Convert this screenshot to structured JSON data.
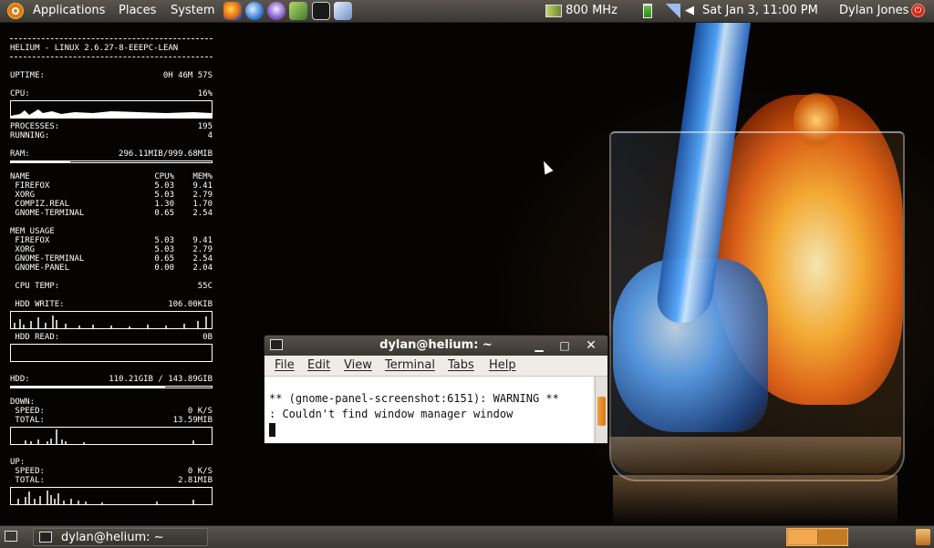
{
  "top_panel": {
    "menus": [
      "Applications",
      "Places",
      "System"
    ],
    "cpu_freq": "800 MHz",
    "datetime": "Sat Jan  3, 11:00 PM",
    "user": "Dylan Jones"
  },
  "conky": {
    "header": "HELIUM - LINUX 2.6.27-8-EEEPC-LEAN",
    "uptime_label": "UPTIME:",
    "uptime_value": "0H 46M 57S",
    "cpu_label": "CPU:",
    "cpu_value": "16%",
    "processes_label": "PROCESSES:",
    "processes_value": "195",
    "running_label": "RUNNING:",
    "running_value": "4",
    "ram_label": "RAM:",
    "ram_value": "296.11MIB/999.68MIB",
    "ram_fraction": 0.296,
    "top_cpu": {
      "header": [
        "NAME",
        "CPU%",
        "MEM%"
      ],
      "rows": [
        [
          " FIREFOX",
          "5.03",
          "9.41"
        ],
        [
          " XORG",
          "5.03",
          "2.79"
        ],
        [
          " COMPIZ.REAL",
          "1.30",
          "1.70"
        ],
        [
          " GNOME-TERMINAL",
          "0.65",
          "2.54"
        ]
      ]
    },
    "top_mem": {
      "header": "MEM USAGE",
      "rows": [
        [
          " FIREFOX",
          "5.03",
          "9.41"
        ],
        [
          " XORG",
          "5.03",
          "2.79"
        ],
        [
          " GNOME-TERMINAL",
          "0.65",
          "2.54"
        ],
        [
          " GNOME-PANEL",
          "0.00",
          "2.04"
        ]
      ]
    },
    "cpu_temp_label": " CPU TEMP:",
    "cpu_temp_value": "55C",
    "hdd_write_label": " HDD WRITE:",
    "hdd_write_value": "106.00KIB",
    "hdd_read_label": " HDD READ:",
    "hdd_read_value": "0B",
    "hdd_label": "HDD:",
    "hdd_value": "110.21GIB / 143.89GIB",
    "hdd_fraction": 0.766,
    "down_label": "DOWN:",
    "down_speed_label": " SPEED:",
    "down_speed_value": "0 K/S",
    "down_total_label": " TOTAL:",
    "down_total_value": "13.59MIB",
    "up_label": "UP:",
    "up_speed_label": " SPEED:",
    "up_speed_value": "0 K/S",
    "up_total_label": " TOTAL:",
    "up_total_value": "2.81MIB"
  },
  "terminal": {
    "title": "dylan@helium: ~",
    "menu": [
      "File",
      "Edit",
      "View",
      "Terminal",
      "Tabs",
      "Help"
    ],
    "lines": [
      "** (gnome-panel-screenshot:6151): WARNING **",
      ": Couldn't find window manager window"
    ]
  },
  "bottom_panel": {
    "task_label": "dylan@helium: ~"
  },
  "icons": {
    "launchers": [
      "firefox-icon",
      "thunderbird-icon",
      "pidgin-icon",
      "synaptic-icon",
      "terminal-icon",
      "screenshot-icon"
    ]
  }
}
